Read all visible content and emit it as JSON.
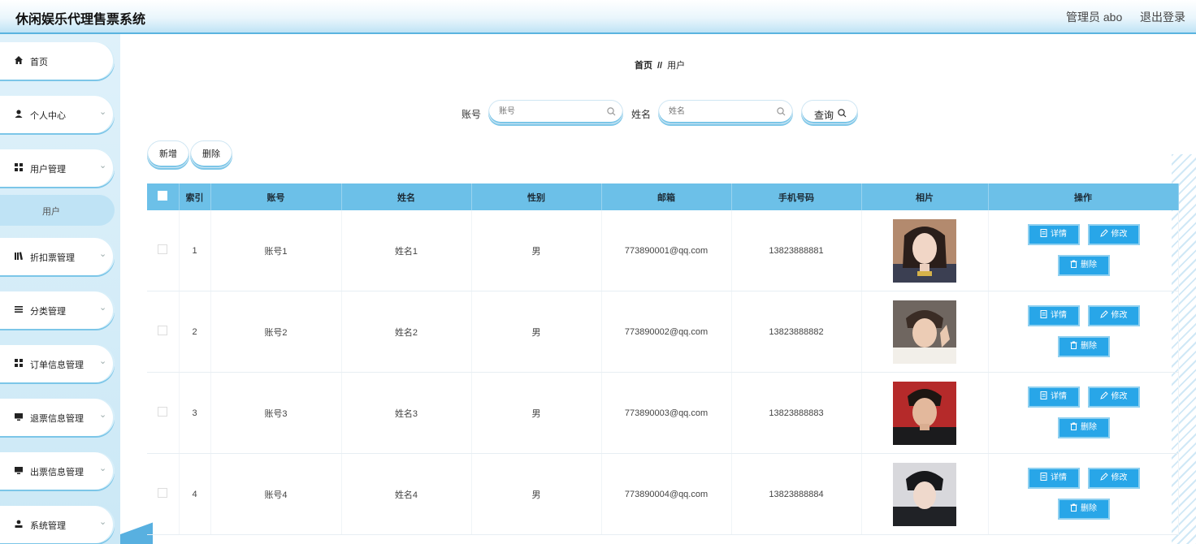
{
  "header": {
    "title": "休闲娱乐代理售票系统",
    "admin": "管理员 abo",
    "logout": "退出登录"
  },
  "sidebar": {
    "items": [
      {
        "label": "首页",
        "icon": "home-icon"
      },
      {
        "label": "个人中心",
        "icon": "person-icon"
      },
      {
        "label": "用户管理",
        "icon": "grid-icon"
      },
      {
        "label": "折扣票管理",
        "icon": "books-icon"
      },
      {
        "label": "分类管理",
        "icon": "list-icon"
      },
      {
        "label": "订单信息管理",
        "icon": "grid-icon"
      },
      {
        "label": "退票信息管理",
        "icon": "monitor-icon"
      },
      {
        "label": "出票信息管理",
        "icon": "monitor-icon"
      },
      {
        "label": "系统管理",
        "icon": "user-settings-icon"
      }
    ],
    "subitem": "用户"
  },
  "breadcrumb": {
    "home": "首页",
    "sep": "//",
    "current": "用户"
  },
  "search": {
    "account_label": "账号",
    "account_placeholder": "账号",
    "name_label": "姓名",
    "name_placeholder": "姓名",
    "query_label": "查询"
  },
  "actions": {
    "add": "新增",
    "delete": "删除"
  },
  "table": {
    "headers": [
      "索引",
      "账号",
      "姓名",
      "性别",
      "邮箱",
      "手机号码",
      "相片",
      "操作"
    ],
    "rows": [
      {
        "index": "1",
        "account": "账号1",
        "name": "姓名1",
        "gender": "男",
        "email": "773890001@qq.com",
        "phone": "13823888881"
      },
      {
        "index": "2",
        "account": "账号2",
        "name": "姓名2",
        "gender": "男",
        "email": "773890002@qq.com",
        "phone": "13823888882"
      },
      {
        "index": "3",
        "account": "账号3",
        "name": "姓名3",
        "gender": "男",
        "email": "773890003@qq.com",
        "phone": "13823888883"
      },
      {
        "index": "4",
        "account": "账号4",
        "name": "姓名4",
        "gender": "男",
        "email": "773890004@qq.com",
        "phone": "13823888884"
      }
    ],
    "ops": {
      "detail": "详情",
      "edit": "修改",
      "delete": "删除"
    }
  },
  "colors": {
    "accent": "#6cc0e8",
    "button": "#28a6e8",
    "header_border": "#5ab4e0"
  }
}
